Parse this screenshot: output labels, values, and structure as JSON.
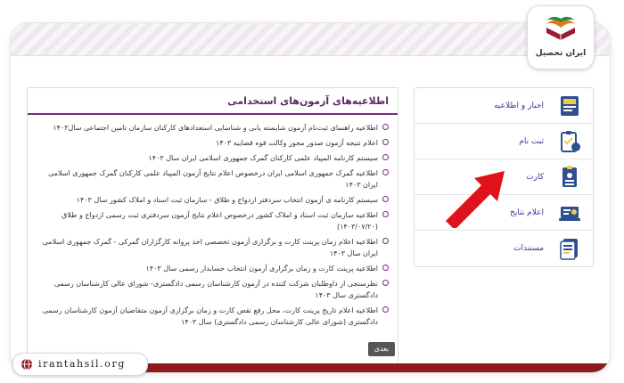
{
  "logo": {
    "text": "ایران تحصیل"
  },
  "panel": {
    "title": "اطلاعیه‌های آزمون‌های استخدامی",
    "items": [
      "اطلاعیه راهنمای ثبت‌نام آزمون شایسته یابی و شناسایی استعدادهای کارکنان سازمان تامین اجتماعی سال۱۴۰۳",
      "اعلام نتیجه آزمون صدور مجوز وکالت قوه قضاییه ۱۴۰۳",
      "سیستم کارنامه المپیاد علمی کارکنان گمرک جمهوری اسلامی ایران سال ۱۴۰۳",
      "اطلاعیه گمرک جمهوری اسلامی ایران درخصوص اعلام نتایج آزمون المپیاد علمی کارکنان گمرک جمهوری اسلامی ایران ۱۴۰۳",
      "سیستم کارنامه ی آزمون انتخاب سردفتر ازدواج و طلاق - سازمان ثبت اسناد و املاک کشور سال ۱۴۰۳",
      "اطلاعیه سازمان ثبت اسناد و املاک کشور درخصوص اعلام نتایج آزمون سردفتری ثبت رسمی ازدواج و طلاق (۱۴۰۳/۰۷/۲۰)",
      "اطلاعیه اعلام زمان پرینت کارت و برگزاری آزمون تخصصی اخذ پروانه کارگزاران گمرکی - گمرک جمهوری اسلامی ایران سال ۱۴۰۳",
      "اطلاعیه پرینت کارت و زمان برگزاری آزمون انتخاب حسابدار رسمی سال ۱۴۰۳",
      "نظرسنجی از داوطلبان شرکت کننده در آزمون کارشناسان رسمی دادگستری- شورای عالی کارشناسان رسمی دادگستری سال ۱۴۰۳",
      "اطلاعیه اعلام تاریخ پرینت کارت، محل رفع نقص کارت و زمان برگزاری آزمون متقاضیان آزمون کارشناسان رسمی دادگستری (شورای عالی کارشناسان رسمی دادگستری) سال ۱۴۰۳"
    ],
    "more_label": "بعدی"
  },
  "menu": [
    {
      "label": "اخبار و اطلاعیه",
      "icon": "news-board-icon"
    },
    {
      "label": "ثبت نام",
      "icon": "registration-clipboard-icon"
    },
    {
      "label": "کارت",
      "icon": "id-card-icon"
    },
    {
      "label": "اعلام نتایج",
      "icon": "results-laptop-icon"
    },
    {
      "label": "مستندات",
      "icon": "documents-icon"
    }
  ],
  "site": {
    "url": "irantahsil.org"
  },
  "colors": {
    "accent": "#7a2a82",
    "arrow": "#e0121c",
    "footer": "#8e1a1f"
  }
}
